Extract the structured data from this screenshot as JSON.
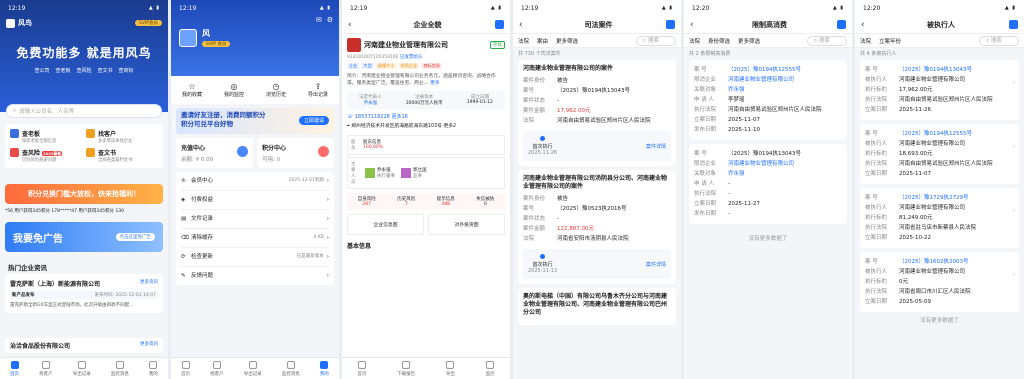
{
  "p1": {
    "time": "12:19",
    "app": "风鸟",
    "vip": "SVIP会员",
    "slogan": "免费功能多 就是用风鸟",
    "tags": [
      "查公司",
      "查老板",
      "查风险",
      "查文书",
      "查商标"
    ],
    "search": "请输入公司名、人名等",
    "tiles": [
      {
        "t": "查老板",
        "s": "探索老板全貌信息"
      },
      {
        "t": "找客户",
        "s": "多多零成本找企业"
      },
      {
        "t": "查风险",
        "s": "识别风险规避问题",
        "b": "2025最新"
      },
      {
        "t": "查文书",
        "s": "全网各类裁判文书"
      }
    ],
    "banner": "积分兑换门槛大放松，快来抢福利！",
    "ticker": "*56 用户获得345积分   178*****47 用户获得345积分   130",
    "ad": "我要免广告",
    "ad_btn": "点击这里免广告",
    "hot": "热门企业资讯",
    "news": [
      {
        "co": "雷克萨斯（上海）新能源有限公司",
        "more": "更多资讯",
        "tag": "新产品发布",
        "date": "发布时间: 2025-12-01 14:07",
        "txt": "雷克萨斯全新GX车型正式登陆市场，此次升级由四款不同配…"
      },
      {
        "co": "治洽食品股份有限公司",
        "more": "更多资讯"
      }
    ],
    "tabs": [
      "首页",
      "找客户",
      "导出记录",
      "监控消息",
      "我的"
    ]
  },
  "p2": {
    "time": "12:19",
    "name": "风",
    "vip": "SVIP 会员",
    "quick": [
      "我的收藏",
      "我的监控",
      "浏览历史",
      "导出记录"
    ],
    "promo": "邀请好友注册，消费同额积分\n积分可兑平台好物",
    "promo_btn": "立即邀请",
    "rec": {
      "t": "充值中心",
      "s": "余额: ¥ 0.00"
    },
    "pts": {
      "t": "积分中心",
      "s": "可用: 0"
    },
    "menu": [
      {
        "t": "会员中心",
        "e": "2025-12-01到期"
      },
      {
        "t": "付费权益",
        "e": ""
      },
      {
        "t": "文件记录",
        "e": ""
      },
      {
        "t": "清除缓存",
        "e": "0 KB"
      },
      {
        "t": "检查更新",
        "e": "已是最新版本"
      },
      {
        "t": "反馈问题",
        "e": ""
      }
    ],
    "tabs": [
      "首页",
      "找客户",
      "导出记录",
      "监控消息",
      "我的"
    ]
  },
  "p3": {
    "time": "12:19",
    "title": "企业全貌",
    "co": "河南建业物业管理有限公司",
    "status": "存续",
    "code": "91410100712635910E",
    "badge": "已发票抬头",
    "tags": [
      "企业",
      "大型",
      "规模大小",
      "优质企业",
      "商标信息"
    ],
    "intro": "简介：河南建业物业管理有限公司业务务元，涵盖顾问咨询、战略合作等。服务类型广泛，覆盖住宅、商业…",
    "more": "更多",
    "meta": [
      {
        "k": "法定代表人",
        "v": "乔永强"
      },
      {
        "k": "注册资本",
        "v": "30000万元人民币"
      },
      {
        "k": "成立日期",
        "v": "1999-01-12"
      }
    ],
    "phone": "18537118228 更多16",
    "addr": "郑州经济技术开发区航海路航海东路103号 更多2",
    "share": {
      "t": "股东",
      "name": "股东信息",
      "v": "100.00%"
    },
    "people": [
      {
        "t": "主要人员",
        "n": "乔永强",
        "r": "执行董事"
      },
      {
        "t": "",
        "n": "郭立国",
        "r": "监事"
      }
    ],
    "risk": [
      {
        "k": "自身风险",
        "v": "267"
      },
      {
        "k": "历史风险",
        "v": "7"
      },
      {
        "k": "提示信息",
        "v": "488"
      },
      {
        "k": "失信被执",
        "v": "0"
      }
    ],
    "tiles": [
      "企业信息图",
      "对外投资图"
    ],
    "basic": "基本信息",
    "tabs": [
      "首页",
      "下载报告",
      "导出",
      "监控"
    ]
  },
  "p4": {
    "time": "12:19",
    "title": "司法案件",
    "filters": [
      "法院",
      "案由",
      "更多筛选"
    ],
    "search": "搜索",
    "count": "共 730 个司法案件",
    "cases": [
      {
        "t": "河南建业物业管理有限公司的案件",
        "rows": [
          [
            "案件身份",
            "被告"
          ],
          [
            "案号",
            "（2025）豫0194执13043号"
          ],
          [
            "案件状态",
            "-"
          ],
          [
            "案件金额",
            "17,962.00元"
          ],
          [
            "法院",
            "河南自由贸易试验区郑州片区人民法院"
          ]
        ],
        "tl": "首次执行",
        "date": "2025-11-26",
        "btn": "案件详情"
      },
      {
        "t": "河南建业物业管理有限公司汤阴县分公司、河南建业物业管理有限公司的案件",
        "rows": [
          [
            "案件身份",
            "被告"
          ],
          [
            "案号",
            "（2025）豫0523执2016号"
          ],
          [
            "案件状态",
            "-"
          ],
          [
            "案件金额",
            "122,887.00元"
          ],
          [
            "法院",
            "河南省安阳市汤阴县人民法院"
          ]
        ],
        "tl": "首次执行",
        "date": "2025-11-13",
        "btn": "案件详情"
      }
    ],
    "tail": "奥的斯电梯（中国）有限公司乌鲁木齐分公司与河南建业物业管理有限公司、河南建业物业管理有限公司巴州分公司"
  },
  "p5": {
    "time": "12:20",
    "title": "限制高消费",
    "filters": [
      "法院",
      "身份筛选",
      "更多筛选"
    ],
    "search": "搜索",
    "count": "共 2 条限制高消费",
    "items": [
      {
        "rows": [
          [
            "案  号",
            "（2025）豫0194执12555号"
          ],
          [
            "限消企业",
            "河南建业物业管理有限公司"
          ],
          [
            "关联对象",
            "乔永强"
          ],
          [
            "申 请 人",
            "李梦瑶"
          ],
          [
            "执行法院",
            "河南自由贸易试验区郑州片区人民法院"
          ],
          [
            "立案日期",
            "2025-11-07"
          ],
          [
            "发布日期",
            "2025-11-10"
          ]
        ]
      },
      {
        "rows": [
          [
            "案  号",
            "（2025）豫0194执13043号"
          ],
          [
            "限消企业",
            "河南建业物业管理有限公司"
          ],
          [
            "关联对象",
            "乔永强"
          ],
          [
            "申 请 人",
            "-"
          ],
          [
            "执行法院",
            "-"
          ],
          [
            "立案日期",
            "2025-11-27"
          ],
          [
            "发布日期",
            "-"
          ]
        ]
      }
    ],
    "end": "没有更多数据了"
  },
  "p6": {
    "time": "12:20",
    "title": "被执行人",
    "filters": [
      "法院",
      "立案年份"
    ],
    "search": "搜索",
    "count": "共 4 条被执行人",
    "items": [
      {
        "rows": [
          [
            "案  号",
            "（2025）豫0194执13043号"
          ],
          [
            "被执行人",
            "河南建业物业管理有限公司"
          ],
          [
            "执行标的",
            "17,962.00元"
          ],
          [
            "执行法院",
            "河南自由贸易试验区郑州片区人民法院"
          ],
          [
            "立案日期",
            "2025-11-26"
          ]
        ]
      },
      {
        "rows": [
          [
            "案  号",
            "（2025）豫0194执12555号"
          ],
          [
            "被执行人",
            "河南建业物业管理有限公司"
          ],
          [
            "执行标的",
            "18,693.00元"
          ],
          [
            "执行法院",
            "河南自由贸易试验区郑州片区人民法院"
          ],
          [
            "立案日期",
            "2025-11-07"
          ]
        ]
      },
      {
        "rows": [
          [
            "案  号",
            "（2025）豫1729执2729号"
          ],
          [
            "被执行人",
            "河南建业物业管理有限公司"
          ],
          [
            "执行标的",
            "81,249.00元"
          ],
          [
            "执行法院",
            "河南省驻马店市新蔡县人民法院"
          ],
          [
            "立案日期",
            "2025-10-22"
          ]
        ]
      },
      {
        "rows": [
          [
            "案  号",
            "（2025）豫1602执2003号"
          ],
          [
            "被执行人",
            "河南建业物业管理有限公司"
          ],
          [
            "执行标的",
            "0元"
          ],
          [
            "执行法院",
            "河南省周口市川汇区人民法院"
          ],
          [
            "立案日期",
            "2025-05-09"
          ]
        ]
      }
    ],
    "end": "没有更多数据了"
  }
}
